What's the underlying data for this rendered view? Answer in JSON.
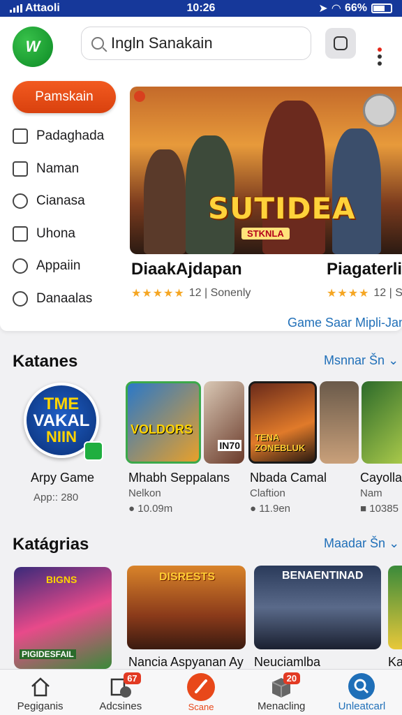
{
  "status_bar": {
    "carrier": "Attaoli",
    "time": "10:26",
    "battery": "66%"
  },
  "header": {
    "search_value": "Ingln Sanakain"
  },
  "sidebar": {
    "primary_button": "Pamskain",
    "items": [
      {
        "label": "Padaghada",
        "icon": "edit-square-icon"
      },
      {
        "label": "Naman",
        "icon": "dot-square-icon"
      },
      {
        "label": "Cianasa",
        "icon": "pencil-circle-icon"
      },
      {
        "label": "Uhona",
        "icon": "grid-icon"
      },
      {
        "label": "Appaiin",
        "icon": "search-icon"
      },
      {
        "label": "Danaalas",
        "icon": "chat-icon"
      }
    ]
  },
  "featured": {
    "hero_title": "SUTIDEA",
    "hero_subtitle": "STKNLA",
    "games": [
      {
        "title": "DiaakAjdapan",
        "stars": "★★★★★",
        "rating_text": "12 | Sonenly"
      },
      {
        "title": "Piagaterli",
        "stars": "★★★★",
        "rating_text": "12 | S"
      }
    ],
    "link": "Game Saar Mipli-Jam"
  },
  "section1": {
    "title": "Katanes",
    "link": "Msnnar Šn",
    "big_logo_lines": [
      "TME",
      "VAKAL",
      "NIIN"
    ],
    "apps": [
      {
        "name": "Arpy Game",
        "sub": "App:: 280",
        "meta": "",
        "art": "VOLDORS"
      },
      {
        "name": "Mhabh Seppalans",
        "sub": "Nelkon",
        "meta": "10.09m",
        "art": "IN70"
      },
      {
        "name": "Nbada Camal",
        "sub": "Claftion",
        "meta": "11.9en",
        "art": "TENA ZONEBLUK"
      },
      {
        "name": "Cayollar",
        "sub": "Nam",
        "meta": "10385",
        "art": ""
      }
    ]
  },
  "section2": {
    "title": "Katágrias",
    "link": "Maadar Šn",
    "apps": [
      {
        "name": "",
        "art_title": "BIGNS",
        "art_sub": "PIGIDESFAIL"
      },
      {
        "name": "Nancia Aspyanan Ay",
        "art_title": "DISRESTS",
        "art_sub": ""
      },
      {
        "name": "Neuciamlba",
        "art_title": "BENAENTINAD",
        "art_sub": ""
      },
      {
        "name": "Ka",
        "art_title": "",
        "art_sub": ""
      }
    ]
  },
  "bottom_nav": [
    {
      "label": "Pegiganis",
      "icon": "home-icon",
      "badge": ""
    },
    {
      "label": "Adcsines",
      "icon": "library-icon",
      "badge": "67"
    },
    {
      "label": "Scane",
      "icon": "phone-icon",
      "badge": ""
    },
    {
      "label": "Menacling",
      "icon": "box-icon",
      "badge": "20"
    },
    {
      "label": "Unleatcarl",
      "icon": "search-icon",
      "badge": ""
    }
  ],
  "colors": {
    "accent": "#1f6fb8",
    "primary": "#e24d13",
    "status_bar": "#16389a"
  }
}
